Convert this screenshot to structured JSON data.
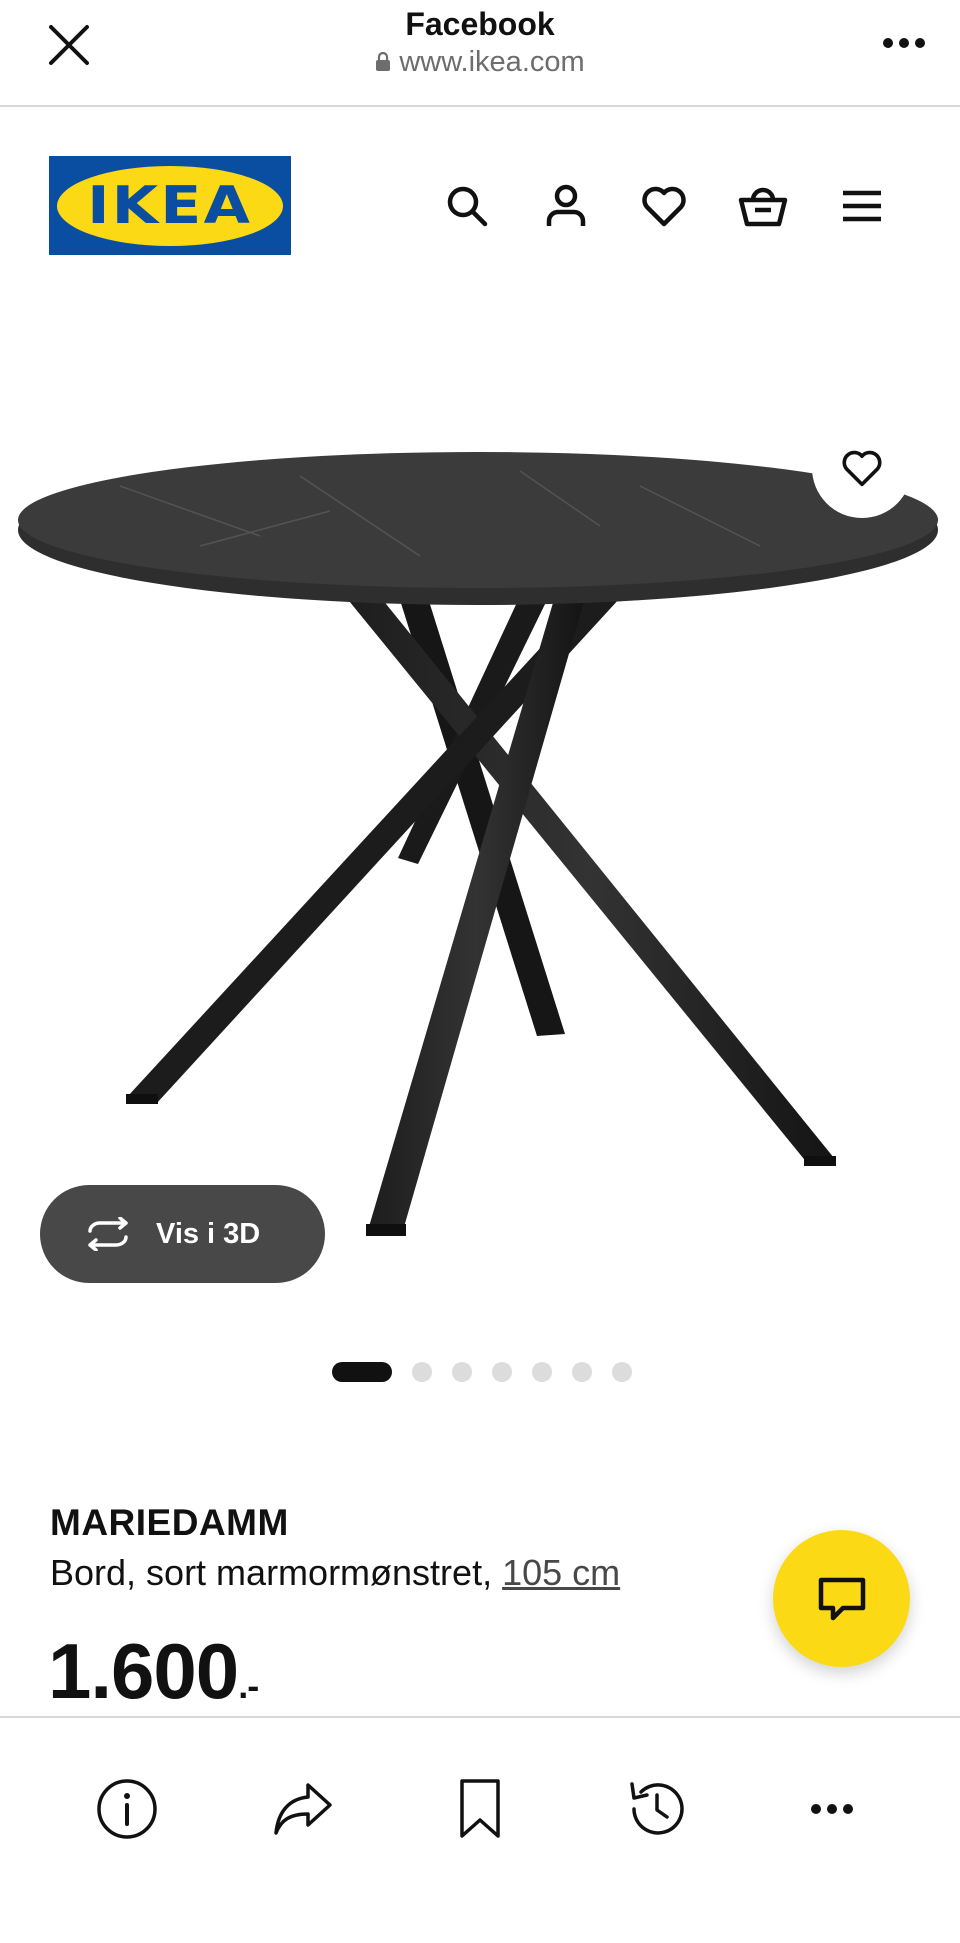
{
  "browser": {
    "title": "Facebook",
    "url": "www.ikea.com",
    "icons": {
      "close": "close-icon",
      "lock": "lock-icon",
      "more": "more-icon"
    }
  },
  "header": {
    "logo_text": "IKEA",
    "icons": [
      "search-icon",
      "account-icon",
      "heart-icon",
      "basket-icon",
      "menu-icon"
    ]
  },
  "product": {
    "vis3d_label": "Vis i 3D",
    "carousel": {
      "count": 7,
      "active": 0
    },
    "name": "MARIEDAMM",
    "description": "Bord, sort marmormønstret, ",
    "size_link": "105 cm",
    "price": "1.600",
    "price_suffix": ".-"
  },
  "bottom_toolbar": {
    "icons": [
      "info-icon",
      "share-icon",
      "bookmark-icon",
      "history-icon",
      "more-icon"
    ]
  },
  "colors": {
    "ikea_blue": "#0a4ea2",
    "ikea_yellow": "#fbd914",
    "vis3d_bg": "#484848"
  }
}
